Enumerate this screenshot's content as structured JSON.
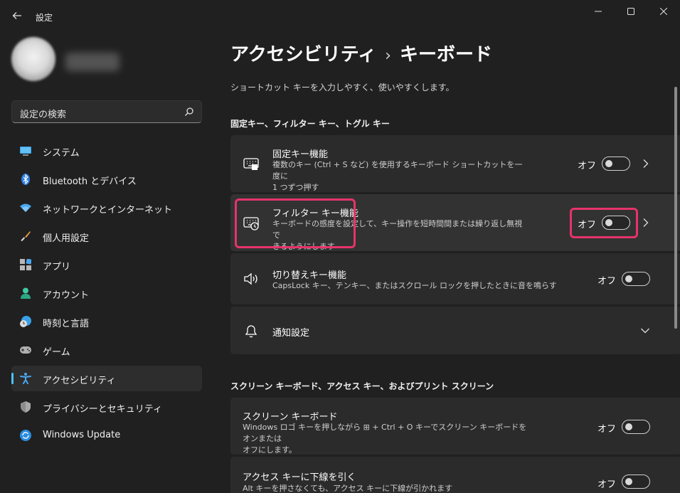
{
  "window": {
    "title": "設定",
    "controls": [
      "minimize-icon",
      "maximize-icon",
      "close-icon"
    ]
  },
  "search": {
    "placeholder": "設定の検索",
    "icon": "search-icon"
  },
  "nav": {
    "items": [
      {
        "label": "システム",
        "icon": "display-icon",
        "active": false
      },
      {
        "label": "Bluetooth とデバイス",
        "icon": "bluetooth-icon",
        "active": false
      },
      {
        "label": "ネットワークとインターネット",
        "icon": "wifi-icon",
        "active": false
      },
      {
        "label": "個人用設定",
        "icon": "brush-icon",
        "active": false
      },
      {
        "label": "アプリ",
        "icon": "apps-icon",
        "active": false
      },
      {
        "label": "アカウント",
        "icon": "person-icon",
        "active": false
      },
      {
        "label": "時刻と言語",
        "icon": "clock-globe-icon",
        "active": false
      },
      {
        "label": "ゲーム",
        "icon": "gamepad-icon",
        "active": false
      },
      {
        "label": "アクセシビリティ",
        "icon": "accessibility-icon",
        "active": true
      },
      {
        "label": "プライバシーとセキュリティ",
        "icon": "shield-icon",
        "active": false
      },
      {
        "label": "Windows Update",
        "icon": "update-icon",
        "active": false
      }
    ]
  },
  "main": {
    "breadcrumb": {
      "parent": "アクセシビリティ",
      "separator": "›",
      "current": "キーボード"
    },
    "description": "ショートカット キーを入力しやすく、使いやすくします。",
    "sections": [
      {
        "title": "固定キー、フィルター キー、トグル キー",
        "cards": [
          {
            "title": "固定キー機能",
            "desc_line1": "複数のキー (Ctrl + S など) を使用するキーボード ショートカットを一度に",
            "desc_line2": "1 つずつ押す",
            "state": "オフ"
          },
          {
            "title": "フィルター キー機能",
            "desc_line1": "キーボードの感度を設定して、キー操作を短時間間または繰り返し無視で",
            "desc_line2": "きるようにします",
            "state": "オフ"
          },
          {
            "title": "切り替えキー機能",
            "desc_line1": "CapsLock キー、テンキー、またはスクロール ロックを押したときに音を鳴らす",
            "state": "オフ"
          },
          {
            "title": "通知設定"
          }
        ]
      },
      {
        "title": "スクリーン キーボード、アクセス キー、およびプリント スクリーン",
        "cards": [
          {
            "title": "スクリーン キーボード",
            "desc_line1": "Windows ロゴ キーを押しながら ⊞ + Ctrl + O キーでスクリーン キーボードをオンまたは",
            "desc_line2": "オフにします。",
            "state": "オフ"
          },
          {
            "title": "アクセス キーに下線を引く",
            "desc_line1": "Alt キーを押さなくても、アクセス キーに下線が引かれます",
            "state": "オフ"
          }
        ]
      }
    ]
  },
  "colors": {
    "background": "#202020",
    "card": "#2b2b2b",
    "accent": "#4cc2ff",
    "highlight": "#e6336b"
  }
}
